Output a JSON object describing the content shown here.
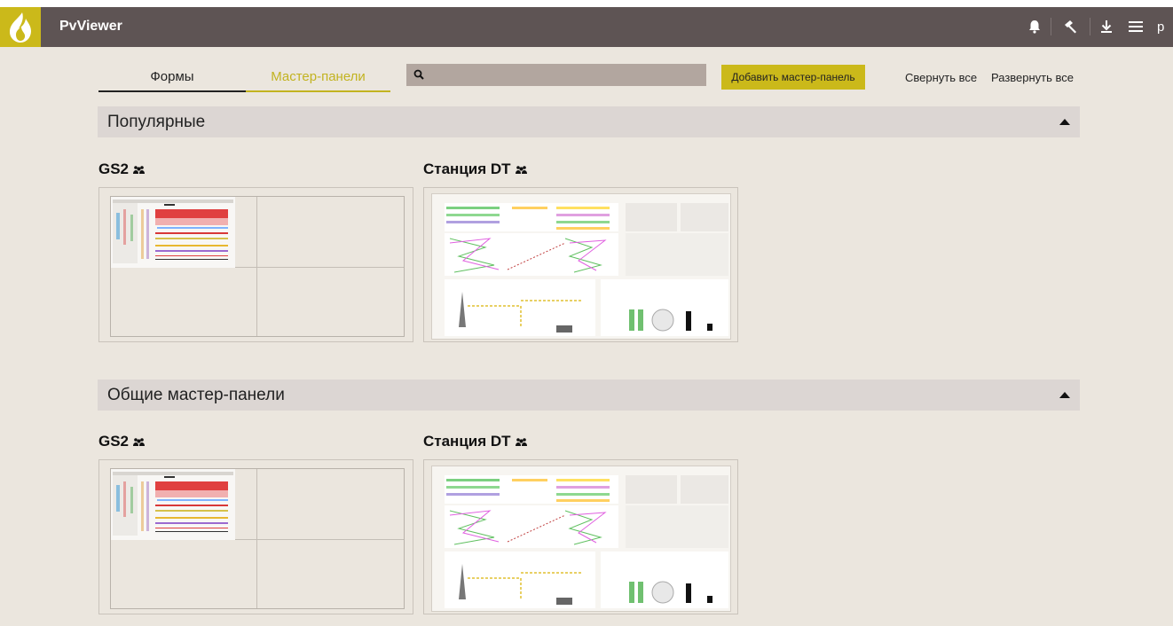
{
  "app": {
    "title": "PvViewer",
    "user": "p"
  },
  "toolbar": {
    "icons": [
      "bell-icon",
      "hammer-icon",
      "download-icon",
      "menu-icon"
    ]
  },
  "tabs": [
    {
      "label": "Формы",
      "active": false
    },
    {
      "label": "Мастер-панели",
      "active": true
    }
  ],
  "search": {
    "value": "",
    "placeholder": ""
  },
  "actions": {
    "add_label": "Добавить мастер-панель",
    "collapse_all": "Свернуть все",
    "expand_all": "Развернуть все"
  },
  "sections": [
    {
      "title": "Популярные",
      "cards": [
        {
          "title": "GS2"
        },
        {
          "title": "Станция DT"
        }
      ]
    },
    {
      "title": "Общие мастер-панели",
      "cards": [
        {
          "title": "GS2"
        },
        {
          "title": "Станция DT"
        }
      ]
    }
  ],
  "colors": {
    "topbar": "#5e5454",
    "accent": "#cbb91a",
    "background": "#ebe6de",
    "section_bar": "#dcd6d3"
  }
}
